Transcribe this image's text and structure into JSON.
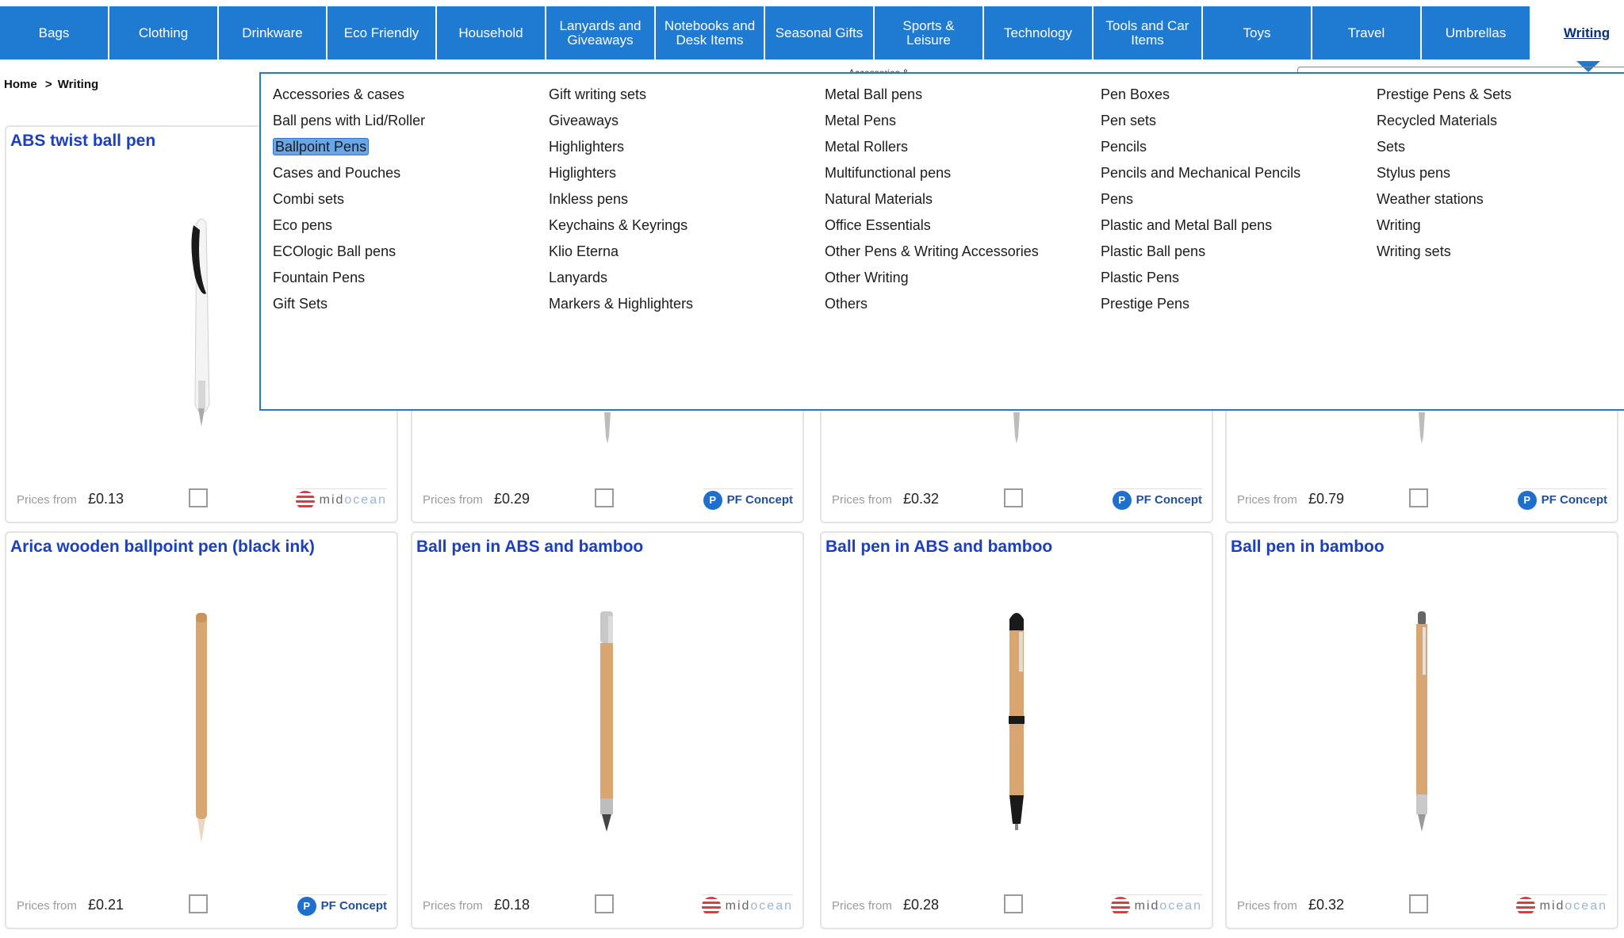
{
  "nav": {
    "items": [
      {
        "label": "Bags"
      },
      {
        "label": "Clothing"
      },
      {
        "label": "Drinkware"
      },
      {
        "label": "Eco Friendly"
      },
      {
        "label": "Household"
      },
      {
        "label": "Lanyards and Giveaways"
      },
      {
        "label": "Notebooks and Desk Items"
      },
      {
        "label": "Seasonal Gifts"
      },
      {
        "label": "Sports & Leisure"
      },
      {
        "label": "Technology"
      },
      {
        "label": "Tools and Car Items"
      },
      {
        "label": "Toys"
      },
      {
        "label": "Travel"
      },
      {
        "label": "Umbrellas"
      },
      {
        "label": "Writing"
      }
    ],
    "active": "Writing",
    "accent_color": "#1f7ad1"
  },
  "breadcrumb": {
    "home": "Home",
    "separator": ">",
    "current": "Writing"
  },
  "menu": {
    "columns": [
      [
        "Accessories & cases",
        "Ball pens with Lid/Roller",
        "Ballpoint Pens",
        "Cases and Pouches",
        "Combi sets",
        "Eco pens",
        "ECOlogic Ball pens",
        "Fountain Pens",
        "Gift Sets"
      ],
      [
        "Gift writing sets",
        "Giveaways",
        "Highlighters",
        "Higlighters",
        "Inkless pens",
        "Keychains & Keyrings",
        "Klio Eterna",
        "Lanyards",
        "Markers & Highlighters"
      ],
      [
        "Metal Ball pens",
        "Metal Pens",
        "Metal Rollers",
        "Multifunctional pens",
        "Natural Materials",
        "Office Essentials",
        "Other Pens & Writing Accessories",
        "Other Writing",
        "Others"
      ],
      [
        "Pen Boxes",
        "Pen sets",
        "Pencils",
        "Pencils and Mechanical Pencils",
        "Pens",
        "Plastic and Metal Ball pens",
        "Plastic Ball pens",
        "Plastic Pens",
        "Prestige Pens"
      ],
      [
        "Prestige Pens & Sets",
        "Recycled Materials",
        "Sets",
        "Stylus pens",
        "Weather stations",
        "Writing",
        "Writing sets"
      ]
    ],
    "highlighted": "Ballpoint Pens",
    "peek_text": "Accessories &"
  },
  "products": [
    {
      "title": "ABS twist ball pen",
      "prices_from": "Prices from",
      "price": "£0.13",
      "supplier": "midocean",
      "pen": "white-twist"
    },
    {
      "title": "",
      "prices_from": "Prices from",
      "price": "£0.29",
      "supplier": "PF Concept",
      "pen": "hidden"
    },
    {
      "title": "",
      "prices_from": "Prices from",
      "price": "£0.32",
      "supplier": "PF Concept",
      "pen": "hidden"
    },
    {
      "title": "",
      "prices_from": "Prices from",
      "price": "£0.79",
      "supplier": "PF Concept",
      "pen": "hidden"
    },
    {
      "title": "Arica wooden ballpoint pen (black ink)",
      "prices_from": "Prices from",
      "price": "£0.21",
      "supplier": "PF Concept",
      "pen": "wood-slim"
    },
    {
      "title": "Ball pen in ABS and bamboo",
      "prices_from": "Prices from",
      "price": "£0.18",
      "supplier": "midocean",
      "pen": "bamboo-stylus"
    },
    {
      "title": "Ball pen in ABS and bamboo",
      "prices_from": "Prices from",
      "price": "£0.28",
      "supplier": "midocean",
      "pen": "bamboo-black"
    },
    {
      "title": "Ball pen in bamboo",
      "prices_from": "Prices from",
      "price": "£0.32",
      "supplier": "midocean",
      "pen": "bamboo-plain"
    }
  ],
  "suppliers": {
    "midocean": {
      "part1": "mid",
      "part2": "ocean"
    },
    "pf": {
      "mark": "P",
      "name": "PF Concept"
    }
  },
  "colors": {
    "title": "#1a3fbf",
    "nav_bg": "#1f7ad1",
    "bamboo": "#d9a672"
  }
}
